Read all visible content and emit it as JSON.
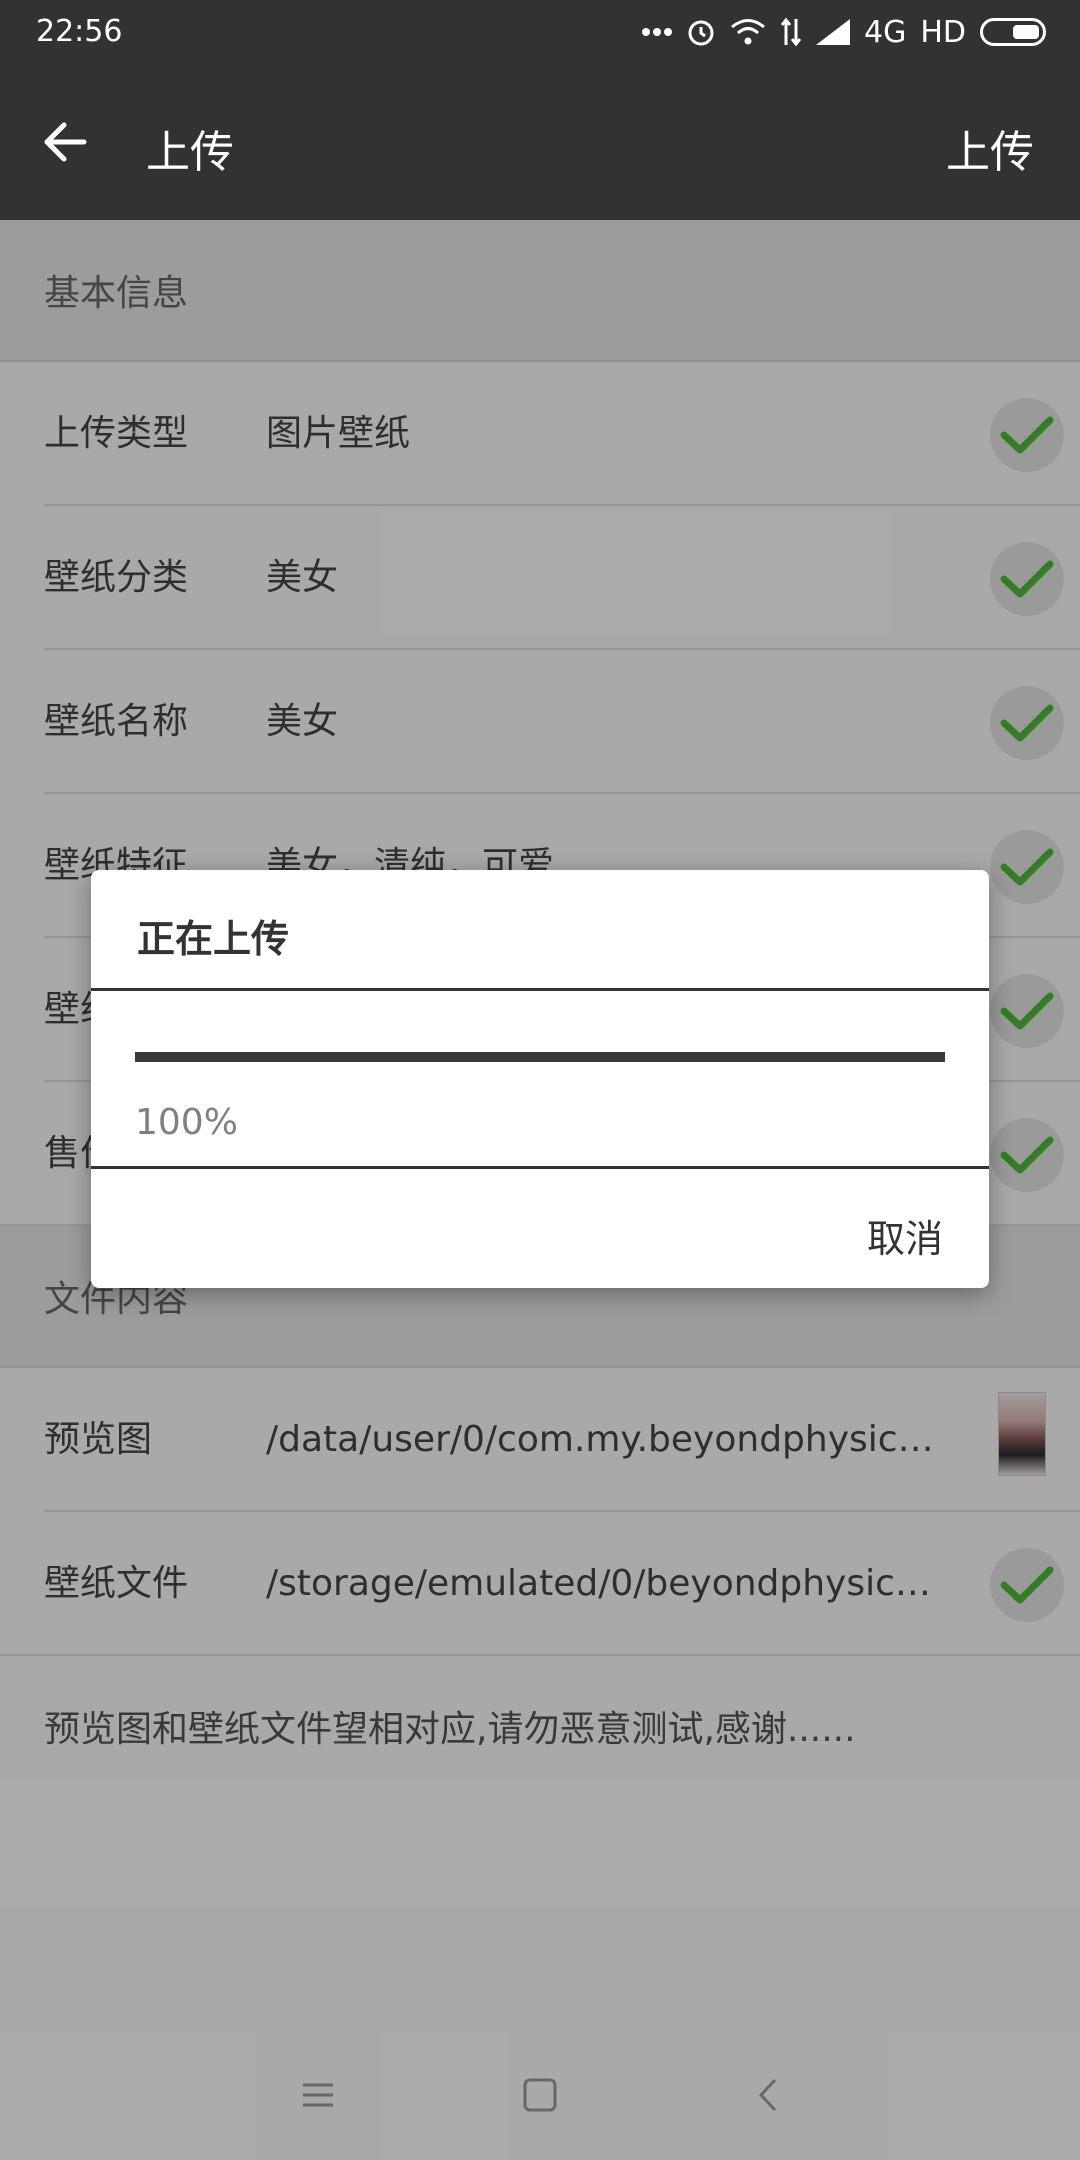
{
  "status_bar": {
    "time": "22:56",
    "network": "4G",
    "hd": "HD",
    "icons": [
      "more-dots-icon",
      "alarm-icon",
      "wifi-icon",
      "data-arrows-icon",
      "signal-icon",
      "battery-icon"
    ]
  },
  "app_bar": {
    "title": "上传",
    "action": "上传",
    "back_icon": "arrow-left-icon"
  },
  "section_basic": {
    "title": "基本信息"
  },
  "rows_basic": [
    {
      "label": "上传类型",
      "value": "图片壁纸",
      "checked": true
    },
    {
      "label": "壁纸分类",
      "value": "美女",
      "checked": true
    },
    {
      "label": "壁纸名称",
      "value": "美女",
      "checked": true
    },
    {
      "label": "壁纸特征",
      "value": "美女，清纯，可爱",
      "checked": true
    },
    {
      "label": "壁纸",
      "value": "",
      "checked": true
    },
    {
      "label": "售价",
      "value": "",
      "checked": true
    }
  ],
  "section_files": {
    "title": "文件内容"
  },
  "rows_files": [
    {
      "label": "预览图",
      "value": "/data/user/0/com.my.beyondphysics...",
      "thumbnail": true
    },
    {
      "label": "壁纸文件",
      "value": "/storage/emulated/0/beyondphysics/...",
      "checked": true
    }
  ],
  "note": "预览图和壁纸文件望相对应,请勿恶意测试,感谢......",
  "dialog": {
    "title": "正在上传",
    "progress": 1.0,
    "percent_label": "100%",
    "cancel_label": "取消"
  },
  "nav_bar": {
    "icons": [
      "menu-icon",
      "home-square-icon",
      "back-chevron-icon"
    ]
  },
  "colors": {
    "app_bar": "#323232",
    "check": "#4cb93a",
    "scrim": "rgba(0,0,0,0.32)"
  }
}
